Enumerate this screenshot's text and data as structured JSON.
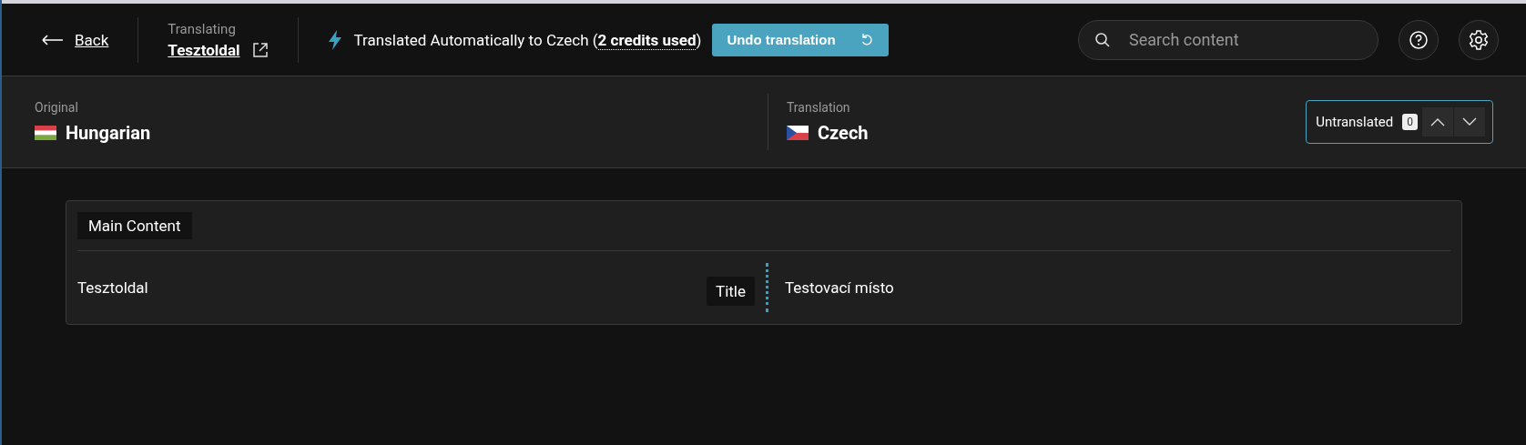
{
  "top_bar": {
    "back": "Back",
    "context_label": "Translating",
    "page_title": "Tesztoldal",
    "status_prefix": "Translated Automatically to Czech (",
    "status_link": "2 credits used",
    "status_suffix": ")",
    "undo_button": "Undo translation",
    "search": {
      "placeholder": "Search content"
    }
  },
  "languages": {
    "original_label": "Original",
    "original": "Hungarian",
    "translation_label": "Translation",
    "translation": "Czech",
    "untranslated_label": "Untranslated",
    "untranslated_count": "0"
  },
  "section": {
    "title": "Main Content",
    "rows": [
      {
        "field": "Title",
        "original": "Tesztoldal",
        "translation": "Testovací místo"
      }
    ]
  }
}
